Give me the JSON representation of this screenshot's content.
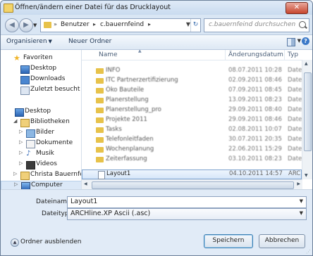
{
  "window": {
    "title": "Öffnen/ändern einer Datei für das Drucklayout",
    "close_label": "✕"
  },
  "navigation": {
    "back_icon": "back-arrow-icon",
    "forward_icon": "forward-arrow-icon",
    "address_parts": [
      "Benutzer",
      "c.bauernfeind"
    ],
    "search_placeholder": "c.bauernfeind durchsuchen"
  },
  "toolbar": {
    "organize_label": "Organisieren",
    "new_folder_label": "Neuer Ordner"
  },
  "sidebar": {
    "favorites_label": "Favoriten",
    "favorites": [
      "Desktop",
      "Downloads",
      "Zuletzt besucht"
    ],
    "desktop_label": "Desktop",
    "libraries_label": "Bibliotheken",
    "libraries": [
      "Bilder",
      "Dokumente",
      "Musik",
      "Videos"
    ],
    "user_label": "Christa Bauernfeind",
    "computer_label": "Computer"
  },
  "file_list": {
    "columns": {
      "name": "Name",
      "date": "Änderungsdatum",
      "type": "Typ"
    },
    "rows": [
      {
        "name": "INFO",
        "date": "08.07.2011 10:28",
        "type": "Date"
      },
      {
        "name": "ITC Partnerzertifizierung",
        "date": "02.09.2011 08:46",
        "type": "Date"
      },
      {
        "name": "Öko Bauteile",
        "date": "07.09.2011 08:45",
        "type": "Date"
      },
      {
        "name": "Planerstellung",
        "date": "13.09.2011 08:23",
        "type": "Date"
      },
      {
        "name": "Planerstellung_pro",
        "date": "29.09.2011 08:40",
        "type": "Date"
      },
      {
        "name": "Projekte 2011",
        "date": "29.09.2011 08:46",
        "type": "Date"
      },
      {
        "name": "Tasks",
        "date": "02.08.2011 10:07",
        "type": "Date"
      },
      {
        "name": "Telefonleitfaden",
        "date": "30.07.2011 20:35",
        "type": "Date"
      },
      {
        "name": "Wochenplanung",
        "date": "22.06.2011 15:29",
        "type": "Date"
      },
      {
        "name": "Zeiterfassung",
        "date": "03.10.2011 08:23",
        "type": "Date"
      }
    ],
    "selected": {
      "name": "Layout1",
      "date": "04.10.2011 14:57",
      "type": "ARC"
    }
  },
  "form": {
    "filename_label": "Dateiname:",
    "filename_value": "Layout1",
    "filetype_label": "Dateityp:",
    "filetype_value": "ARCHline.XP Ascii (.asc)"
  },
  "footer": {
    "hide_folders_label": "Ordner ausblenden",
    "open_label": "Speichern",
    "cancel_label": "Abbrechen"
  }
}
